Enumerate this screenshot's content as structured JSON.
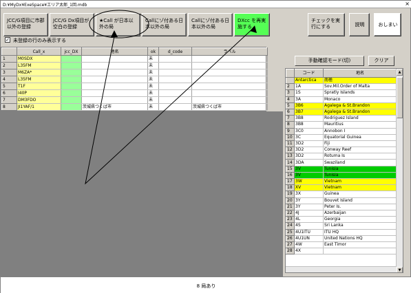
{
  "window": {
    "title": "D:¥MyDx¥ExeSpace¥エリア太郎_1回.mdb",
    "close_glyph": "×"
  },
  "toolbar": {
    "btn1": "JCC/G項目に市郡以外の登録",
    "btn2": "JCC/G Dx項目が空白の登録",
    "btn3": "★Call が日本以外の局",
    "btn4": "Callにゾ付ある日本以外の局",
    "btn5": "Callにゾ付ある日本以外の局",
    "btn6": "DXcc を再実施する",
    "btn_check": "チェックを実行にする",
    "btn_help": "説明",
    "btn_close": "おしまい"
  },
  "filter": {
    "checkbox_checked": "✓",
    "checkbox_label": "未登録の行のみ表示する"
  },
  "grid": {
    "headers": [
      "",
      "Call_x",
      "jcc_DX",
      "地名",
      "ok",
      "d_code",
      "ラベル"
    ],
    "rows": [
      [
        "1",
        "M0SDX",
        "",
        "",
        "未",
        "",
        ""
      ],
      [
        "2",
        "L35FM",
        "",
        "",
        "未",
        "",
        ""
      ],
      [
        "3",
        "M6ZA*",
        "",
        "",
        "未",
        "",
        ""
      ],
      [
        "4",
        "L35FM",
        "",
        "",
        "未",
        "",
        ""
      ],
      [
        "5",
        "T1F",
        "",
        "",
        "未",
        "",
        ""
      ],
      [
        "6",
        "I40P",
        "",
        "",
        "未",
        "",
        ""
      ],
      [
        "7",
        "DM3FDO",
        "",
        "",
        "未",
        "",
        ""
      ],
      [
        "8",
        "JI1YAF/1",
        "",
        "茨城県つくば市",
        "未",
        "",
        "茨城県つくば市"
      ]
    ]
  },
  "right": {
    "btn_manual": "手動確認モード(切)",
    "btn_clear": "クリア",
    "headers": [
      "",
      "コード",
      "地名"
    ],
    "rows": [
      [
        "",
        "Antarctica",
        "南極",
        "yel"
      ],
      [
        "2",
        "1A",
        "Sov.Mil.Order of Malta",
        ""
      ],
      [
        "3",
        "1S",
        "Spratly Islands",
        ""
      ],
      [
        "4",
        "3A",
        "Monaco",
        ""
      ],
      [
        "5",
        "3B6",
        "Agalega & St.Brandon",
        "yel"
      ],
      [
        "6",
        "3B7",
        "Agalega & St.Brandon",
        "yel"
      ],
      [
        "7",
        "3B8",
        "Rodriguez Island",
        ""
      ],
      [
        "8",
        "3B8",
        "Mauritius",
        ""
      ],
      [
        "9",
        "3C0",
        "Annobon I",
        ""
      ],
      [
        "10",
        "3C",
        "Equatorial Guinea",
        ""
      ],
      [
        "11",
        "3D2",
        "Fiji",
        ""
      ],
      [
        "12",
        "3D2",
        "Conway Reef",
        ""
      ],
      [
        "13",
        "3D2",
        "Rotuma Is",
        ""
      ],
      [
        "14",
        "3DA",
        "Swaziland",
        ""
      ],
      [
        "15",
        "3V",
        "Tunisia",
        "grn"
      ],
      [
        "16",
        "3V",
        "Tunisia",
        "grn"
      ],
      [
        "17",
        "3W",
        "Vietnam",
        "yel"
      ],
      [
        "18",
        "XV",
        "Vietnam",
        "yel"
      ],
      [
        "19",
        "3X",
        "Guinea",
        ""
      ],
      [
        "20",
        "3Y",
        "Bouvet Island",
        ""
      ],
      [
        "21",
        "3Y",
        "Peter Is.",
        ""
      ],
      [
        "22",
        "4J",
        "Azerbaijan",
        ""
      ],
      [
        "23",
        "4L",
        "Georgia",
        ""
      ],
      [
        "24",
        "4S",
        "Sri Lanka",
        ""
      ],
      [
        "25",
        "4U1ITU",
        "ITU HQ",
        ""
      ],
      [
        "26",
        "4U1UN",
        "United Nations HQ",
        ""
      ],
      [
        "27",
        "4W",
        "East Timor",
        ""
      ],
      [
        "28",
        "4X",
        "",
        ""
      ]
    ]
  },
  "status": {
    "text": "8 局あり"
  }
}
